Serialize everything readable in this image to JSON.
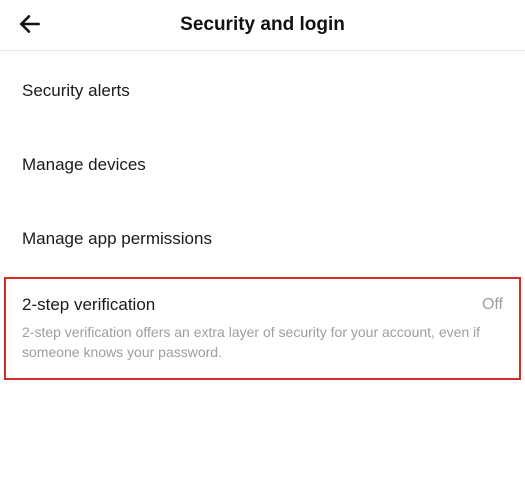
{
  "header": {
    "title": "Security and login"
  },
  "menu": {
    "items": [
      {
        "label": "Security alerts"
      },
      {
        "label": "Manage devices"
      },
      {
        "label": "Manage app permissions"
      }
    ],
    "two_step": {
      "label": "2-step verification",
      "status": "Off",
      "description": "2-step verification offers an extra layer of security for your account, even if someone knows your password."
    }
  }
}
